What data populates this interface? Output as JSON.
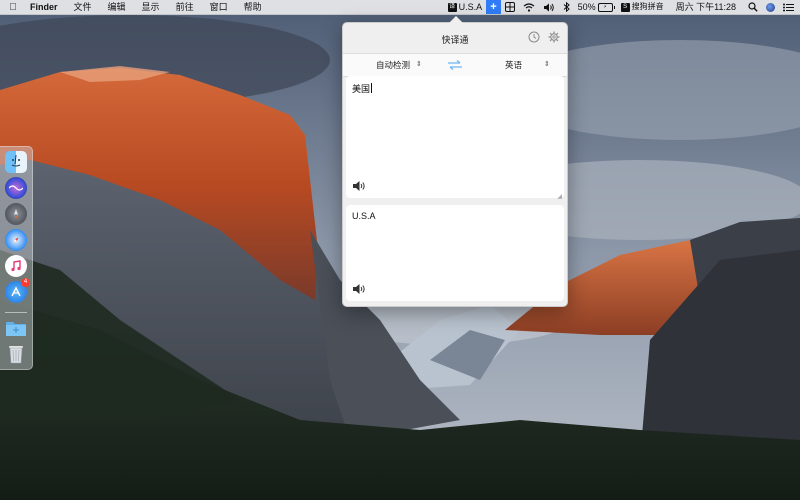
{
  "menubar": {
    "app_name": "Finder",
    "menus": [
      "文件",
      "编辑",
      "显示",
      "前往",
      "窗口",
      "帮助"
    ],
    "status": {
      "translator_text": "U.S.A",
      "battery_percent": "50%",
      "ime_label": "搜狗拼音",
      "datetime": "周六 下午11:28"
    }
  },
  "dock": {
    "apps": [
      "finder-icon",
      "siri-icon",
      "launchpad-icon",
      "safari-icon",
      "itunes-icon",
      "app-store-icon",
      "folder-icon",
      "trash-icon"
    ],
    "app_store_badge": "4"
  },
  "translator": {
    "title": "快译通",
    "source_lang": "自动检测",
    "target_lang": "英语",
    "input_text": "美国",
    "output_text": "U.S.A"
  },
  "colors": {
    "accent": "#2f7cf6",
    "swap_arrow": "#6fb3f2"
  }
}
